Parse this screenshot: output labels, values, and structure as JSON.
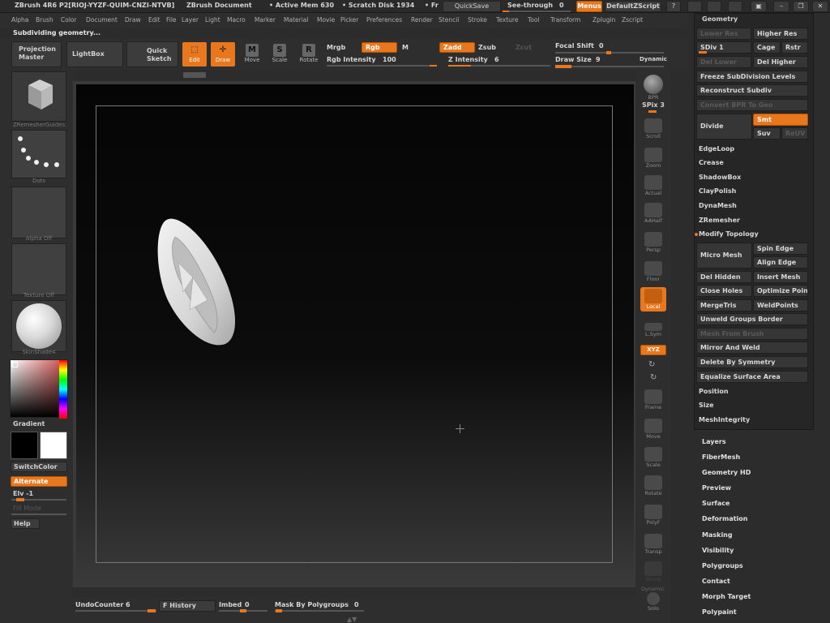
{
  "title_bar": {
    "app": "ZBrush 4R6 P2[RIOJ-YYZF-QUIM-CNZI-NTVB]",
    "document": "ZBrush Document",
    "active_mem": "• Active Mem 630",
    "scratch_disk": "• Scratch Disk 1934",
    "free_trunc": "• Fr",
    "quicksave": "QuickSave",
    "see_through": "See-through",
    "see_through_value": "0",
    "menus": "Menus",
    "script": "DefaultZScript"
  },
  "menu_bar": [
    "Alpha",
    "Brush",
    "Color",
    "Document",
    "Draw",
    "Edit",
    "File",
    "Layer",
    "Light",
    "Macro",
    "Marker",
    "Material",
    "Movie",
    "Picker",
    "Preferences",
    "Render",
    "Stencil",
    "Stroke",
    "Texture",
    "Tool",
    "Transform",
    "Zplugin",
    "Zscript"
  ],
  "status": "Subdividing geometry...",
  "shelf": {
    "projection_master": "Projection Master",
    "lightbox": "LightBox",
    "quick_sketch": "Quick Sketch",
    "edit": "Edit",
    "draw": "Draw",
    "move": "Move",
    "scale": "Scale",
    "rotate": "Rotate",
    "mrgb": "Mrgb",
    "rgb": "Rgb",
    "m": "M",
    "zadd": "Zadd",
    "zsub": "Zsub",
    "zcut": "Zcut",
    "rgb_intensity_label": "Rgb Intensity",
    "rgb_intensity": "100",
    "z_intensity_label": "Z Intensity",
    "z_intensity": "6",
    "focal_shift_label": "Focal Shift",
    "focal_shift": "0",
    "draw_size_label": "Draw Size",
    "draw_size": "9",
    "dynamic": "Dynamic"
  },
  "left_panel": {
    "tool_thumb_label": "ZRemesherGuides",
    "stroke_label": "Dots",
    "alpha_label": "Alpha Off",
    "texture_label": "Texture Off",
    "material_label": "SkinShade4",
    "gradient": "Gradient",
    "switch_color": "SwitchColor",
    "alternate": "Alternate",
    "elv": "Elv -1",
    "fill_mode": "Fill Mode",
    "help": "Help"
  },
  "right_tools": [
    "BPR",
    "SPix 3",
    "Scroll",
    "Zoom",
    "Actual",
    "AAHalf",
    "Persp",
    "Floor",
    "Local",
    "L.Sym",
    "XYZ",
    "Frame",
    "Move",
    "Scale",
    "Rotate",
    "PolyF",
    "Transp",
    "Ghost",
    "Dynamic",
    "Solo"
  ],
  "geometry_palette": {
    "title": "Geometry",
    "lower_res": "Lower Res",
    "higher_res": "Higher Res",
    "sdiv": "SDiv 1",
    "cage": "Cage",
    "rstr": "Rstr",
    "del_lower": "Del Lower",
    "del_higher": "Del Higher",
    "freeze": "Freeze SubDivision Levels",
    "reconstruct": "Reconstruct Subdiv",
    "convert_bpr": "Convert BPR To Geo",
    "divide": "Divide",
    "smt": "Smt",
    "suv": "Suv",
    "reuv": "ReUV",
    "edgeloop": "EdgeLoop",
    "crease": "Crease",
    "shadowbox": "ShadowBox",
    "claypolish": "ClayPolish",
    "dynamesh": "DynaMesh",
    "zremesher": "ZRemesher",
    "modify_topology": "Modify Topology",
    "micro_mesh": "Micro Mesh",
    "spin_edge": "Spin Edge",
    "align_edge": "Align Edge",
    "del_hidden": "Del Hidden",
    "insert_mesh": "Insert Mesh",
    "close_holes": "Close Holes",
    "optimize_points": "Optimize Poin",
    "mergetris": "MergeTris",
    "weldpoints": "WeldPoints",
    "unweld": "Unweld Groups Border",
    "mesh_from_brush": "Mesh From Brush",
    "mirror_weld": "Mirror And Weld",
    "delete_symmetry": "Delete By Symmetry",
    "equalize": "Equalize Surface Area",
    "position": "Position",
    "size": "Size",
    "mesh_integrity": "MeshIntegrity"
  },
  "tool_subpalettes": [
    "Layers",
    "FiberMesh",
    "Geometry HD",
    "Preview",
    "Surface",
    "Deformation",
    "Masking",
    "Visibility",
    "Polygroups",
    "Contact",
    "Morph Target",
    "Polypaint"
  ],
  "bottom_bar": {
    "undo_counter_label": "UndoCounter",
    "undo_counter": "6",
    "f_history": "F History",
    "imbed_label": "Imbed",
    "imbed": "0",
    "mask_polygroups_label": "Mask By Polygroups",
    "mask_polygroups": "0"
  },
  "colors": {
    "accent": "#e8771e",
    "panel": "#2e2e2e",
    "canvas": "#000000"
  }
}
